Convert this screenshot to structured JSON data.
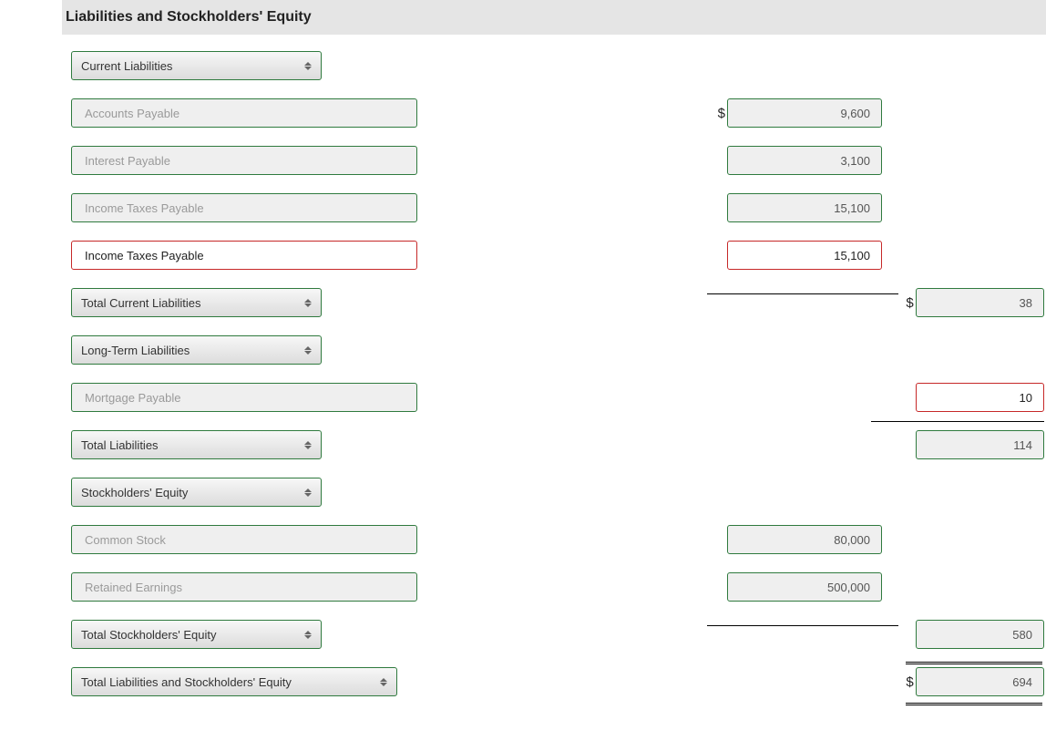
{
  "section_title": "Liabilities and Stockholders' Equity",
  "labels": {
    "current_liabilities": "Current Liabilities",
    "accounts_payable": "Accounts Payable",
    "interest_payable": "Interest Payable",
    "income_taxes_payable": "Income Taxes Payable",
    "income_taxes_payable_active": "Income Taxes Payable",
    "total_current_liabilities": "Total Current Liabilities",
    "long_term_liabilities": "Long-Term Liabilities",
    "mortgage_payable": "Mortgage Payable",
    "total_liabilities": "Total Liabilities",
    "stockholders_equity": "Stockholders' Equity",
    "common_stock": "Common Stock",
    "retained_earnings": "Retained Earnings",
    "total_stockholders_equity": "Total Stockholders' Equity",
    "total_liab_and_equity": "Total Liabilities and Stockholders' Equity"
  },
  "values": {
    "accounts_payable": "9,600",
    "interest_payable": "3,100",
    "income_taxes_payable": "15,100",
    "income_taxes_payable_active": "15,100",
    "total_current_liabilities": "38",
    "mortgage_payable": "10",
    "total_liabilities": "114",
    "common_stock": "80,000",
    "retained_earnings": "500,000",
    "total_stockholders_equity": "580",
    "total_liab_and_equity": "694"
  },
  "currency": "$"
}
